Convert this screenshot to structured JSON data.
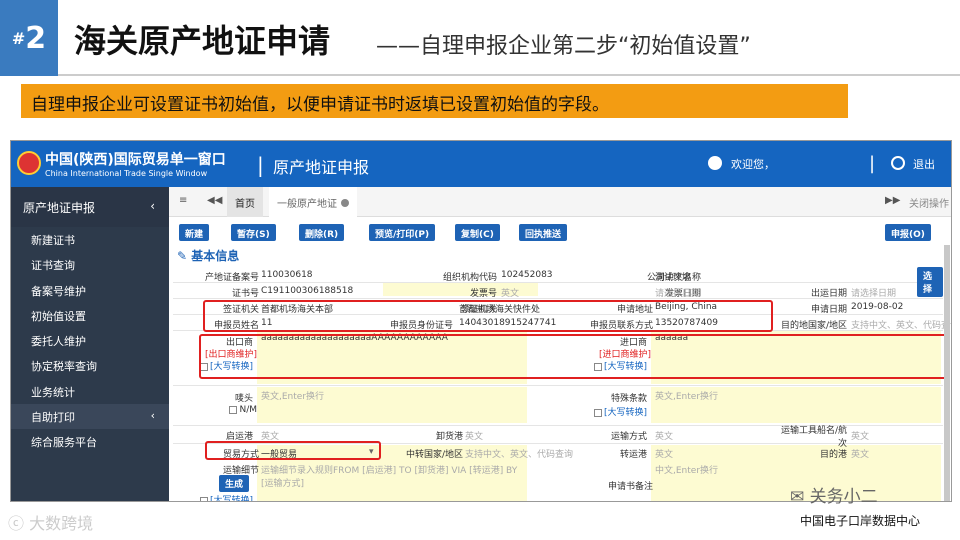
{
  "slide": {
    "badge_hash": "#",
    "badge_num": "2",
    "title": "海关原产地证申请",
    "subtitle": "——自理申报企业第二步“初始值设置”",
    "banner": "自理申报企业可设置证书初始值，以便申请证书时返填已设置初始值的字段。"
  },
  "app": {
    "brand_cn": "中国(陕西)国际贸易单一窗口",
    "brand_en": "China International Trade Single Window",
    "sep": "|",
    "module": "原产地证申报",
    "welcome": "欢迎您，",
    "logout": "退出"
  },
  "sidebar": {
    "header": "原产地证申报",
    "items": [
      "新建证书",
      "证书查询",
      "备案号维护",
      "初始值设置",
      "委托人维护",
      "协定税率查询",
      "业务统计",
      "自助打印",
      "综合服务平台"
    ]
  },
  "tabs": {
    "home": "首页",
    "current": "一般原产地证",
    "close_ops": "关闭操作"
  },
  "toolbar": {
    "new": "新建",
    "save": "暂存(S)",
    "delete": "删除(R)",
    "preview": "预览/打印(P)",
    "copy": "复制(C)",
    "push": "回执推送",
    "declare": "申报(O)"
  },
  "section": {
    "title": "基本信息"
  },
  "form": {
    "filing_no_label": "产地证备案号",
    "filing_no": "110030618",
    "org_code_label": "组织机构代码",
    "org_code": "102452083",
    "company_label": "公司中文名称",
    "company": "测试环境",
    "select": "选择",
    "cert_no_label": "证书号",
    "cert_no": "C191100306188518",
    "invoice_no_label": "发票号",
    "invoice_no_ph": "英文",
    "invoice_date_label": "发票日期",
    "invoice_date_ph": "请选择日期",
    "ship_date_label": "出运日期",
    "ship_date_ph": "请选择日期",
    "visa_org_label": "签证机关",
    "visa_org": "首都机场海关本部",
    "collect_org_label": "领证机关",
    "collect_org": "首都机场海关快件处",
    "apply_addr_label": "申请地址",
    "apply_addr": "Beijing, China",
    "apply_date_label": "申请日期",
    "apply_date": "2019-08-02",
    "declarant_label": "申报员姓名",
    "declarant": "11",
    "declarant_id_label": "申报员身份证号",
    "declarant_id": "14043018915247741",
    "declarant_tel_label": "申报员联系方式",
    "declarant_tel": "13520787409",
    "dest_label": "目的地国家/地区",
    "dest_ph": "支持中文、英文、代码查询",
    "exporter_label": "出口商",
    "exporter_maint": "[出口商维护]",
    "uppercase": "[大写转换]",
    "exporter": "aaaaaaaaaaaaaaaaaaaaAAAAAAAAAAAA",
    "importer_label": "进口商",
    "importer_maint": "[进口商维护]",
    "importer": "aaaaaa",
    "mark_label": "唛头",
    "mark_ph": "英文,Enter换行",
    "na": "N/M",
    "special_label": "特殊条款",
    "special_ph": "英文,Enter换行",
    "load_port_label": "启运港",
    "load_port_ph": "英文",
    "unload_port_label": "卸货港",
    "unload_port_ph": "英文",
    "transport_label": "运输方式",
    "transport_ph": "英文",
    "vessel_label": "运输工具船名/航次",
    "vessel_ph": "英文",
    "trade_label": "贸易方式",
    "trade": "一般贸易",
    "transit_country_label": "中转国家/地区",
    "transit_country_ph": "支持中文、英文、代码查询",
    "transit_port_label": "转运港",
    "transit_port_ph": "英文",
    "dest_port_label": "目的港",
    "dest_port_ph": "英文",
    "route_label": "运输细节",
    "route_ph": "运输细节录入规则FROM [启运港] TO [卸货港] VIA [转运港] BY [运输方式]",
    "generate": "生成",
    "remark_label": "申请书备注",
    "remark_ph": "中文,Enter换行"
  },
  "watermark": {
    "left": "大数跨境",
    "right": "关务小二",
    "right2": "中国电子口岸数据中心"
  },
  "colors": {
    "header_blue": "#1565c0",
    "sidebar": "#2d3a4b",
    "banner": "#f39c12",
    "highlight": "#e02020"
  }
}
